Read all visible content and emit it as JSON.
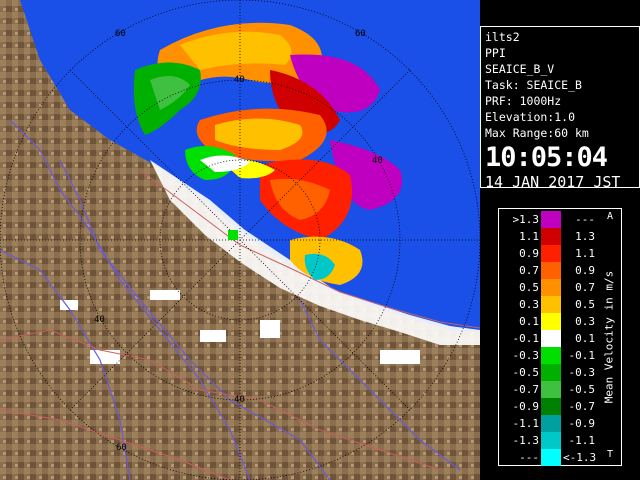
{
  "info": {
    "station": "ilts2",
    "product": "PPI",
    "data_name": "SEAICE_B_V",
    "task": "Task: SEAICE_B",
    "prf": "PRF: 1000Hz",
    "elevation": "Elevation:1.0",
    "max_range": "Max Range:60 km",
    "time": "10:05:04",
    "date": "14 JAN 2017 JST"
  },
  "map": {
    "range_labels": [
      "60",
      "60",
      "40",
      "40",
      "40",
      "40",
      "60"
    ],
    "colors": {
      "sea": "#1a4fe8",
      "land": "#8a6e4e",
      "land_dark": "#5b4530",
      "snow": "#ffffff",
      "river": "#6a5ad8",
      "road": "#c86060",
      "ring": "#000000"
    }
  },
  "legend": {
    "unit": "Mean Velocity in m/s",
    "top_mark": "A",
    "bottom_mark": "T",
    "rows": [
      {
        "lo": ">1.3",
        "hi": "---",
        "color": "#c000c0"
      },
      {
        "lo": "1.1",
        "hi": "1.3",
        "color": "#d00000"
      },
      {
        "lo": "0.9",
        "hi": "1.1",
        "color": "#ff2000"
      },
      {
        "lo": "0.7",
        "hi": "0.9",
        "color": "#ff6000"
      },
      {
        "lo": "0.5",
        "hi": "0.7",
        "color": "#ff9000"
      },
      {
        "lo": "0.3",
        "hi": "0.5",
        "color": "#ffc000"
      },
      {
        "lo": "0.1",
        "hi": "0.3",
        "color": "#ffff00"
      },
      {
        "lo": "-0.1",
        "hi": "0.1",
        "color": "#ffffff"
      },
      {
        "lo": "-0.3",
        "hi": "-0.1",
        "color": "#00e000"
      },
      {
        "lo": "-0.5",
        "hi": "-0.3",
        "color": "#00b000"
      },
      {
        "lo": "-0.7",
        "hi": "-0.5",
        "color": "#40c040"
      },
      {
        "lo": "-0.9",
        "hi": "-0.7",
        "color": "#008000"
      },
      {
        "lo": "-1.1",
        "hi": "-0.9",
        "color": "#00a0a0"
      },
      {
        "lo": "-1.3",
        "hi": "-1.1",
        "color": "#00c8c8"
      },
      {
        "lo": "---",
        "hi": "<-1.3",
        "color": "#00ffff"
      }
    ]
  }
}
